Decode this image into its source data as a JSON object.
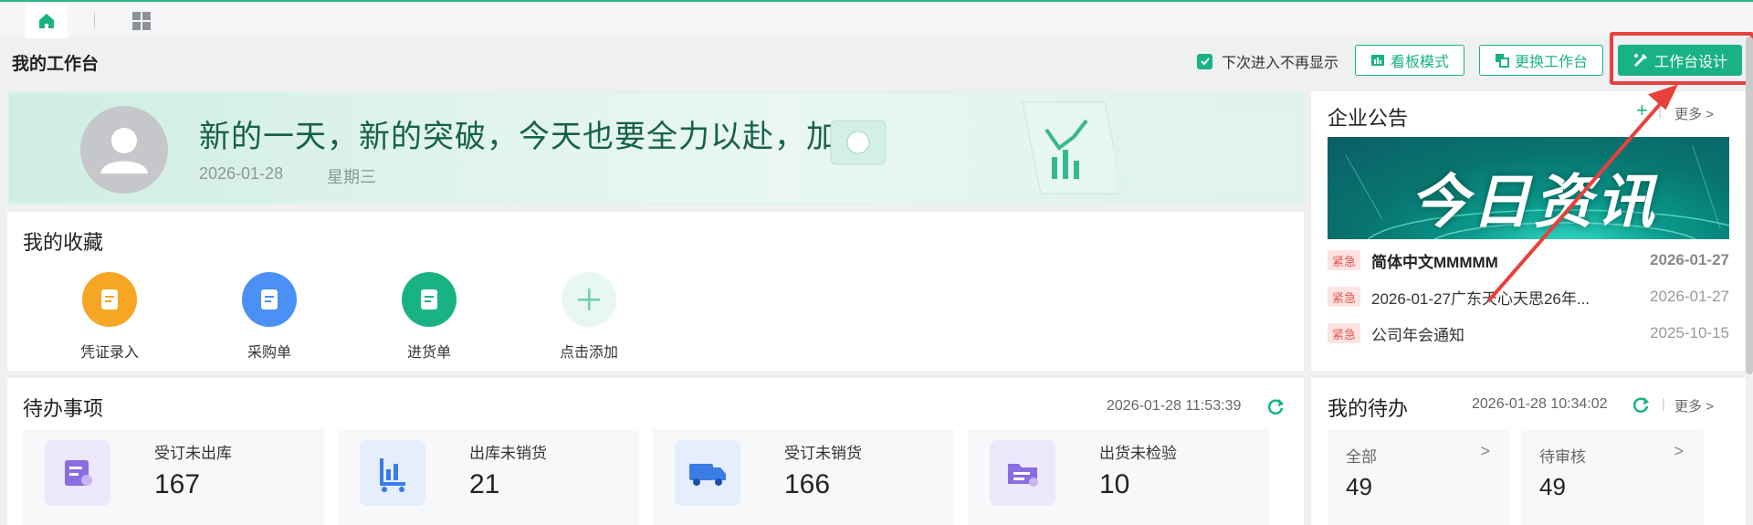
{
  "header": {
    "title": "我的工作台",
    "no_show_label": "下次进入不再显示",
    "board_mode_label": "看板模式",
    "switch_workbench_label": "更换工作台",
    "design_label": "工作台设计"
  },
  "banner": {
    "slogan": "新的一天，新的突破，今天也要全力以赴，加油!",
    "date": "2026-01-28",
    "weekday": "星期三"
  },
  "favorites": {
    "title": "我的收藏",
    "items": [
      {
        "label": "凭证录入",
        "color": "#f5a623"
      },
      {
        "label": "采购单",
        "color": "#4a90f5"
      },
      {
        "label": "进货单",
        "color": "#19b383"
      },
      {
        "label": "点击添加",
        "color": "#e8f7f1"
      }
    ]
  },
  "todo": {
    "title": "待办事项",
    "time": "2026-01-28 11:53:39",
    "items": [
      {
        "label": "受订未出库",
        "value": "167"
      },
      {
        "label": "出库未销货",
        "value": "21"
      },
      {
        "label": "受订未销货",
        "value": "166"
      },
      {
        "label": "出货未检验",
        "value": "10"
      }
    ]
  },
  "notice": {
    "title": "企业公告",
    "add": "+",
    "more": "更多",
    "image_text": "今日资讯",
    "rows": [
      {
        "tag": "紧急",
        "text": "简体中文MMMMM",
        "date": "2026-01-27",
        "bold": true
      },
      {
        "tag": "紧急",
        "text": "2026-01-27广东天心天思26年...",
        "date": "2026-01-27",
        "bold": false
      },
      {
        "tag": "紧急",
        "text": "公司年会通知",
        "date": "2025-10-15",
        "bold": false
      }
    ]
  },
  "my_todo": {
    "title": "我的待办",
    "time": "2026-01-28 10:34:02",
    "more": "更多",
    "cards": [
      {
        "label": "全部",
        "value": "49"
      },
      {
        "label": "待审核",
        "value": "49"
      }
    ]
  },
  "colors": {
    "accent": "#19b383",
    "urgent": "#e05a52",
    "highlight": "#e8413b"
  }
}
